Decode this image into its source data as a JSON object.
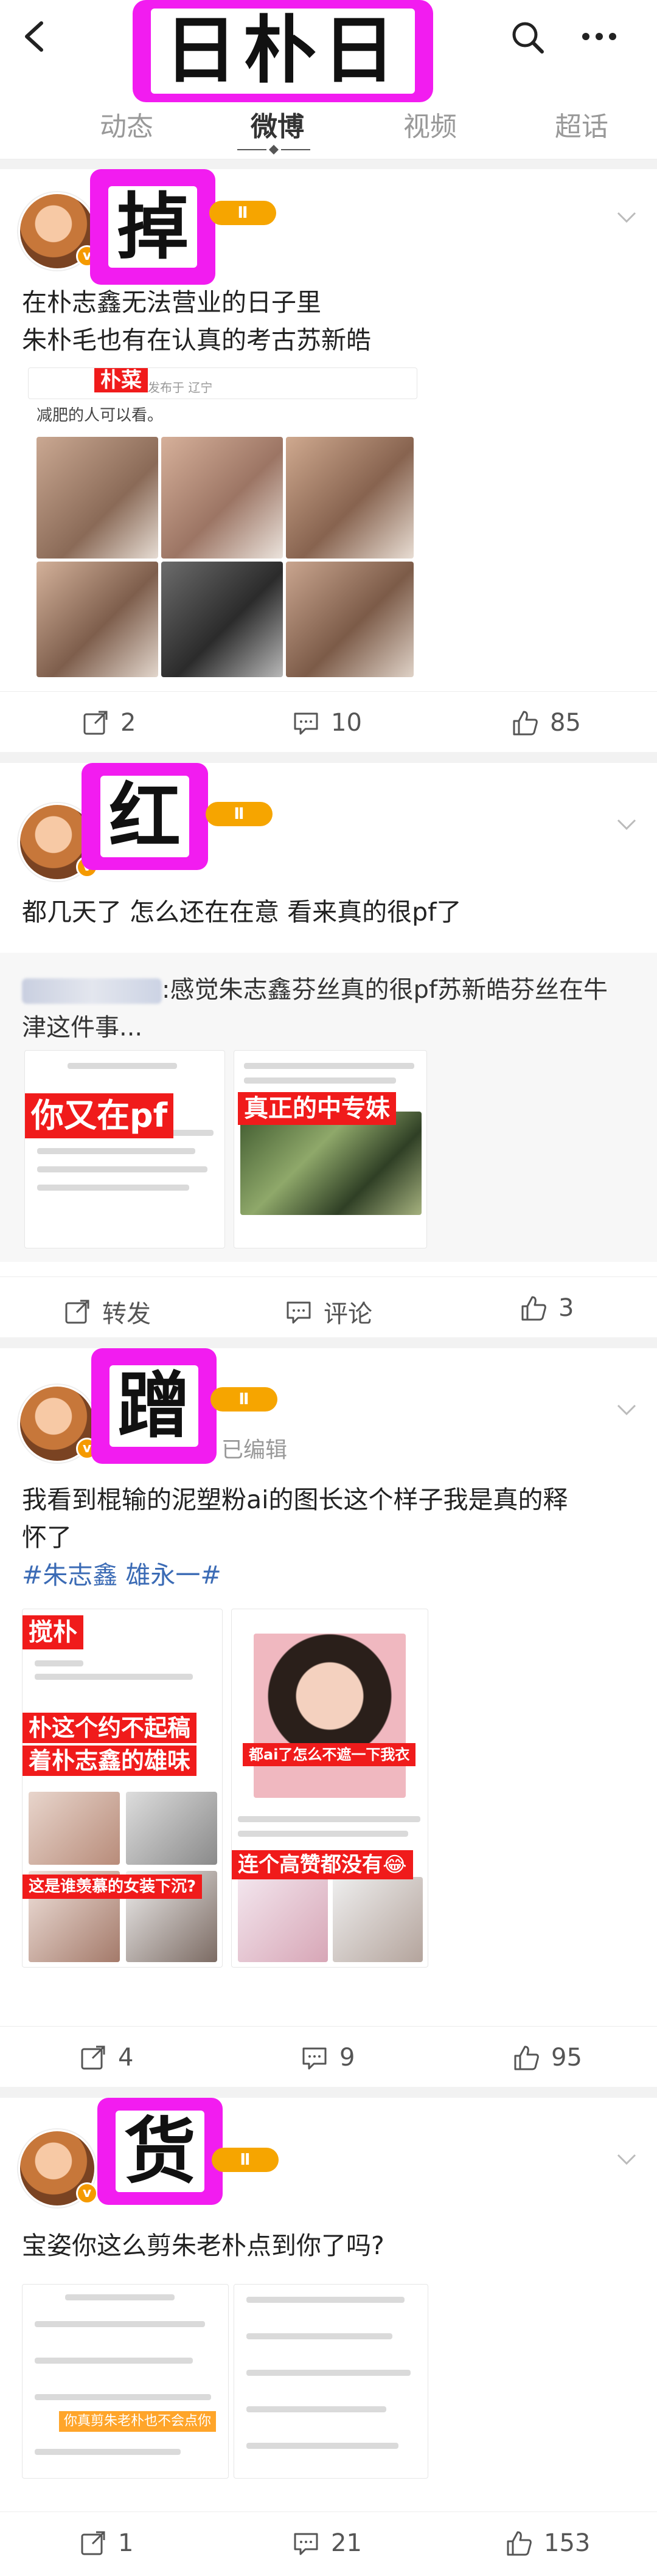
{
  "header": {
    "title_sticker": "日朴日",
    "tabs": [
      {
        "label": "动态"
      },
      {
        "label": "微博"
      },
      {
        "label": "视频"
      },
      {
        "label": "超话"
      }
    ]
  },
  "posts": [
    {
      "sticker": "掉",
      "level": "Ⅱ",
      "text_lines": [
        "在朴志鑫无法营业的日子里",
        "朱朴毛也有在认真的考古苏新皓"
      ],
      "embed": {
        "name_tag": "朴菜",
        "meta": "发布于 辽宁",
        "caption": "减肥的人可以看。"
      },
      "actions": {
        "repost": "2",
        "comment": "10",
        "like": "85"
      }
    },
    {
      "sticker": "红",
      "level": "Ⅱ",
      "text_lines": [
        "都几天了 怎么还在在意 看来真的很pf了"
      ],
      "quote": {
        "line1": ":感觉朱志鑫芬丝真的很pf苏新皓芬丝在牛",
        "line2": "津这件事..."
      },
      "overlays": {
        "left": "你又在pf",
        "right": "真正的中专妹"
      },
      "actions": {
        "repost": "转发",
        "comment": "评论",
        "like": "3"
      }
    },
    {
      "sticker": "蹭",
      "level": "Ⅱ",
      "edited": "已编辑",
      "text_lines": [
        "我看到棍输的泥塑粉ai的图长这个样子我是真的释",
        "怀了"
      ],
      "hashtags": "#朱志鑫 雄永一#",
      "overlays": {
        "tag1": "搅朴",
        "tag2": "朴这个约不起稿",
        "tag3": "着朴志鑫的雄味",
        "tag4": "这是谁羡慕的女装下沉?",
        "tag5": "都ai了怎么不遮一下我衣",
        "tag6": "连个高赞都没有😂"
      },
      "actions": {
        "repost": "4",
        "comment": "9",
        "like": "95"
      }
    },
    {
      "sticker": "货",
      "level": "Ⅱ",
      "text_lines": [
        "宝姿你这么剪朱老朴点到你了吗?"
      ],
      "overlays": {
        "tag": "你真剪朱老朴也不会点你"
      },
      "actions": {
        "repost": "1",
        "comment": "21",
        "like": "153"
      }
    }
  ],
  "colors": {
    "sticker": "#f21cf0",
    "level_badge": "#f6a500",
    "hashtag": "#3b6bb5",
    "redtag": "#f01b1b"
  },
  "icons": [
    "back-icon",
    "search-icon",
    "more-icon",
    "chevron-down-icon",
    "repost-icon",
    "comment-icon",
    "like-icon",
    "verified-icon"
  ]
}
